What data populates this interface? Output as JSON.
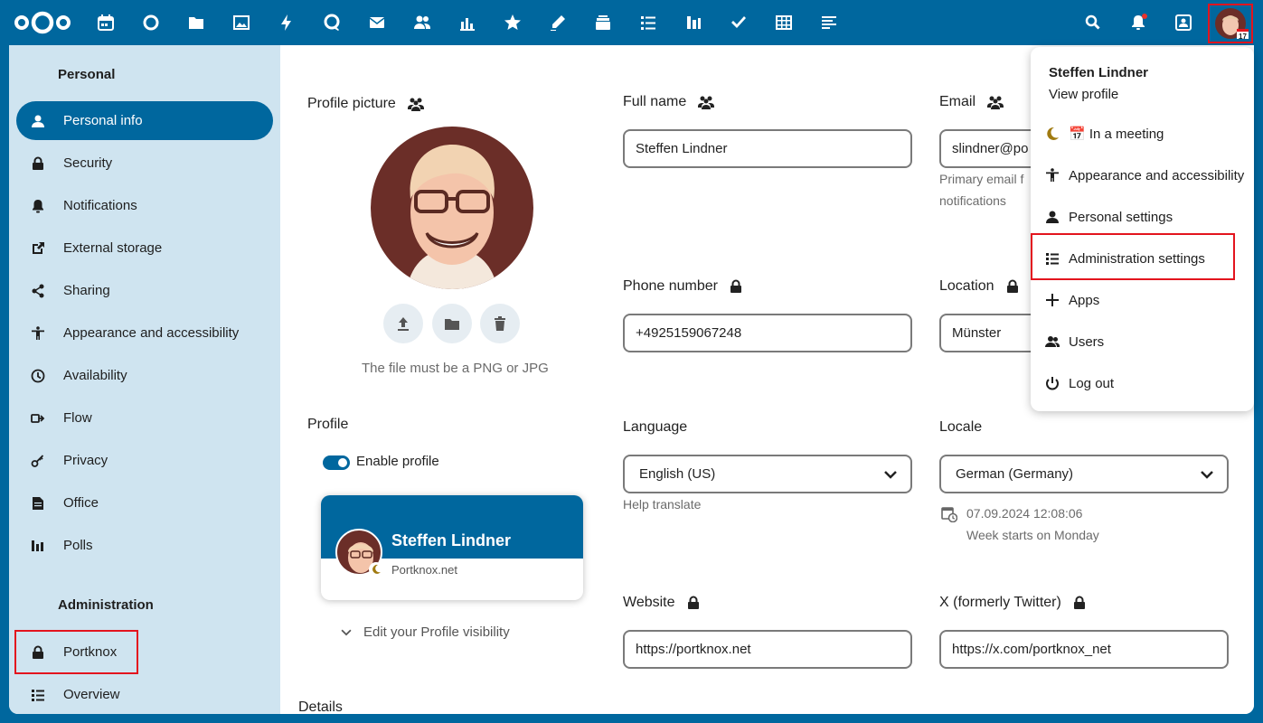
{
  "topbar": {
    "apps": [
      "dashboard-icon",
      "calendar-icon",
      "circle-icon",
      "files-icon",
      "photos-icon",
      "activity-icon",
      "talk-icon",
      "mail-icon",
      "contacts-icon",
      "analytics-icon",
      "favorites-icon",
      "notes-icon",
      "deck-icon",
      "tasks-icon",
      "polls-icon",
      "checkmark-icon",
      "tables-icon",
      "text-icon"
    ],
    "calendar_badge": "17"
  },
  "sidebar": {
    "personal_heading": "Personal",
    "items": [
      {
        "label": "Personal info",
        "icon": "user-icon"
      },
      {
        "label": "Security",
        "icon": "lock-icon"
      },
      {
        "label": "Notifications",
        "icon": "bell-icon"
      },
      {
        "label": "External storage",
        "icon": "external-link-icon"
      },
      {
        "label": "Sharing",
        "icon": "share-icon"
      },
      {
        "label": "Appearance and accessibility",
        "icon": "accessibility-icon"
      },
      {
        "label": "Availability",
        "icon": "clock-icon"
      },
      {
        "label": "Flow",
        "icon": "flow-icon"
      },
      {
        "label": "Privacy",
        "icon": "key-icon"
      },
      {
        "label": "Office",
        "icon": "document-icon"
      },
      {
        "label": "Polls",
        "icon": "poll-icon"
      }
    ],
    "admin_heading": "Administration",
    "admin_items": [
      {
        "label": "Portknox",
        "icon": "lock-icon"
      },
      {
        "label": "Overview",
        "icon": "list-icon"
      }
    ]
  },
  "main": {
    "profile_picture_label": "Profile picture",
    "picture_hint": "The file must be a PNG or JPG",
    "profile_label": "Profile",
    "enable_profile": "Enable profile",
    "card_name": "Steffen Lindner",
    "card_org": "Portknox.net",
    "edit_visibility": "Edit your Profile visibility",
    "details_label": "Details",
    "full_name_label": "Full name",
    "full_name_value": "Steffen Lindner",
    "email_label": "Email",
    "email_value": "slindner@po",
    "email_hint_1": "Primary email f",
    "email_hint_2": "notifications",
    "phone_label": "Phone number",
    "phone_value": "+4925159067248",
    "location_label": "Location",
    "location_value": "Münster",
    "language_label": "Language",
    "language_value": "English (US)",
    "help_translate": "Help translate",
    "locale_label": "Locale",
    "locale_value": "German (Germany)",
    "locale_time": "07.09.2024 12:08:06",
    "week_starts": "Week starts on Monday",
    "website_label": "Website",
    "website_value": "https://portknox.net",
    "twitter_label": "X (formerly Twitter)",
    "twitter_value": "https://x.com/portknox_net"
  },
  "menu": {
    "name": "Steffen Lindner",
    "view_profile": "View profile",
    "items": [
      {
        "label": "📅 In a meeting",
        "icon": "moon-icon"
      },
      {
        "label": "Appearance and accessibility",
        "icon": "accessibility-icon"
      },
      {
        "label": "Personal settings",
        "icon": "user-icon"
      },
      {
        "label": "Administration settings",
        "icon": "admin-list-icon"
      },
      {
        "label": "Apps",
        "icon": "plus-icon"
      },
      {
        "label": "Users",
        "icon": "users-icon"
      },
      {
        "label": "Log out",
        "icon": "power-icon"
      }
    ]
  },
  "colors": {
    "brand": "#00679e",
    "sidebar": "#cfe4f0",
    "highlight": "#e3141e"
  }
}
